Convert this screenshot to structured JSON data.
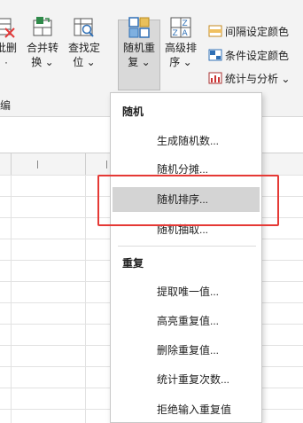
{
  "ribbon": {
    "btn_delete": {
      "line1": "批删",
      "line2": "·"
    },
    "btn_merge": {
      "line1": "合并转",
      "line2": "换 ⌄"
    },
    "btn_find": {
      "line1": "查找定",
      "line2": "位 ⌄"
    },
    "btn_random": {
      "line1": "随机重",
      "line2": "复 ⌄"
    },
    "btn_sort": {
      "line1": "高级排",
      "line2": "序 ⌄"
    },
    "small_items": [
      "间隔设定颜色",
      "条件设定颜色",
      "统计与分析 ⌄"
    ],
    "group_label": "编"
  },
  "menu": {
    "section_random": "随机",
    "random_items": [
      "生成随机数...",
      "随机分摊...",
      "随机排序...",
      "随机抽取..."
    ],
    "section_duplicate": "重复",
    "duplicate_items": [
      "提取唯一值...",
      "高亮重复值...",
      "删除重复值...",
      "统计重复次数...",
      "拒绝输入重复值"
    ],
    "highlighted": "随机排序..."
  },
  "colors": {
    "highlight": "#d4d4d4",
    "annotation": "#e53935",
    "ribbon_bg": "#f3f3f3"
  }
}
